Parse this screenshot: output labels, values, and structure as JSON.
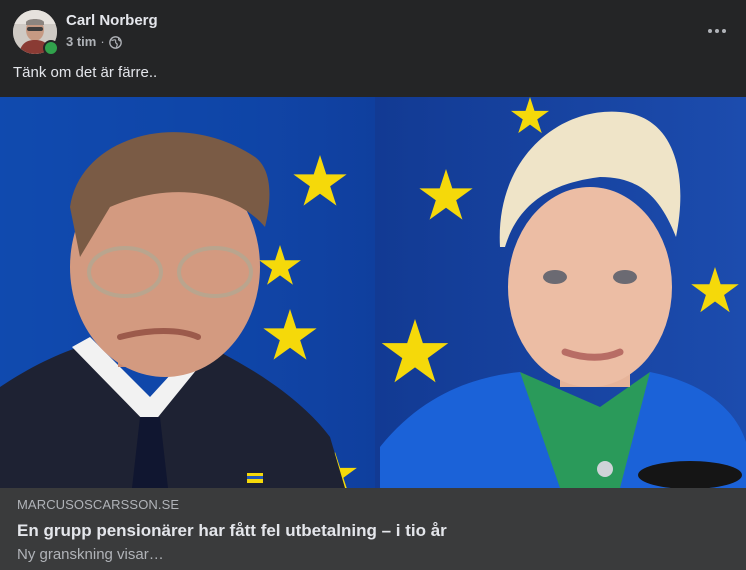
{
  "post": {
    "author": "Carl Norberg",
    "timestamp": "3 tim",
    "separator": "·",
    "privacy_icon": "globe-icon",
    "more_icon": "more-horizontal-icon",
    "text": "Tänk om det är färre.."
  },
  "link": {
    "domain": "MARCUSOSCARSSON.SE",
    "title": "En grupp pensionärer har fått fel utbetalning – i tio år",
    "description": "Ny granskning visar…"
  },
  "colors": {
    "background": "#242526",
    "preview_background": "#3a3b3c",
    "primary_text": "#e4e6eb",
    "secondary_text": "#b0b3b8",
    "online": "#31a24c",
    "eu_blue": "#1b4fb4",
    "eu_star": "#f5d90a"
  }
}
